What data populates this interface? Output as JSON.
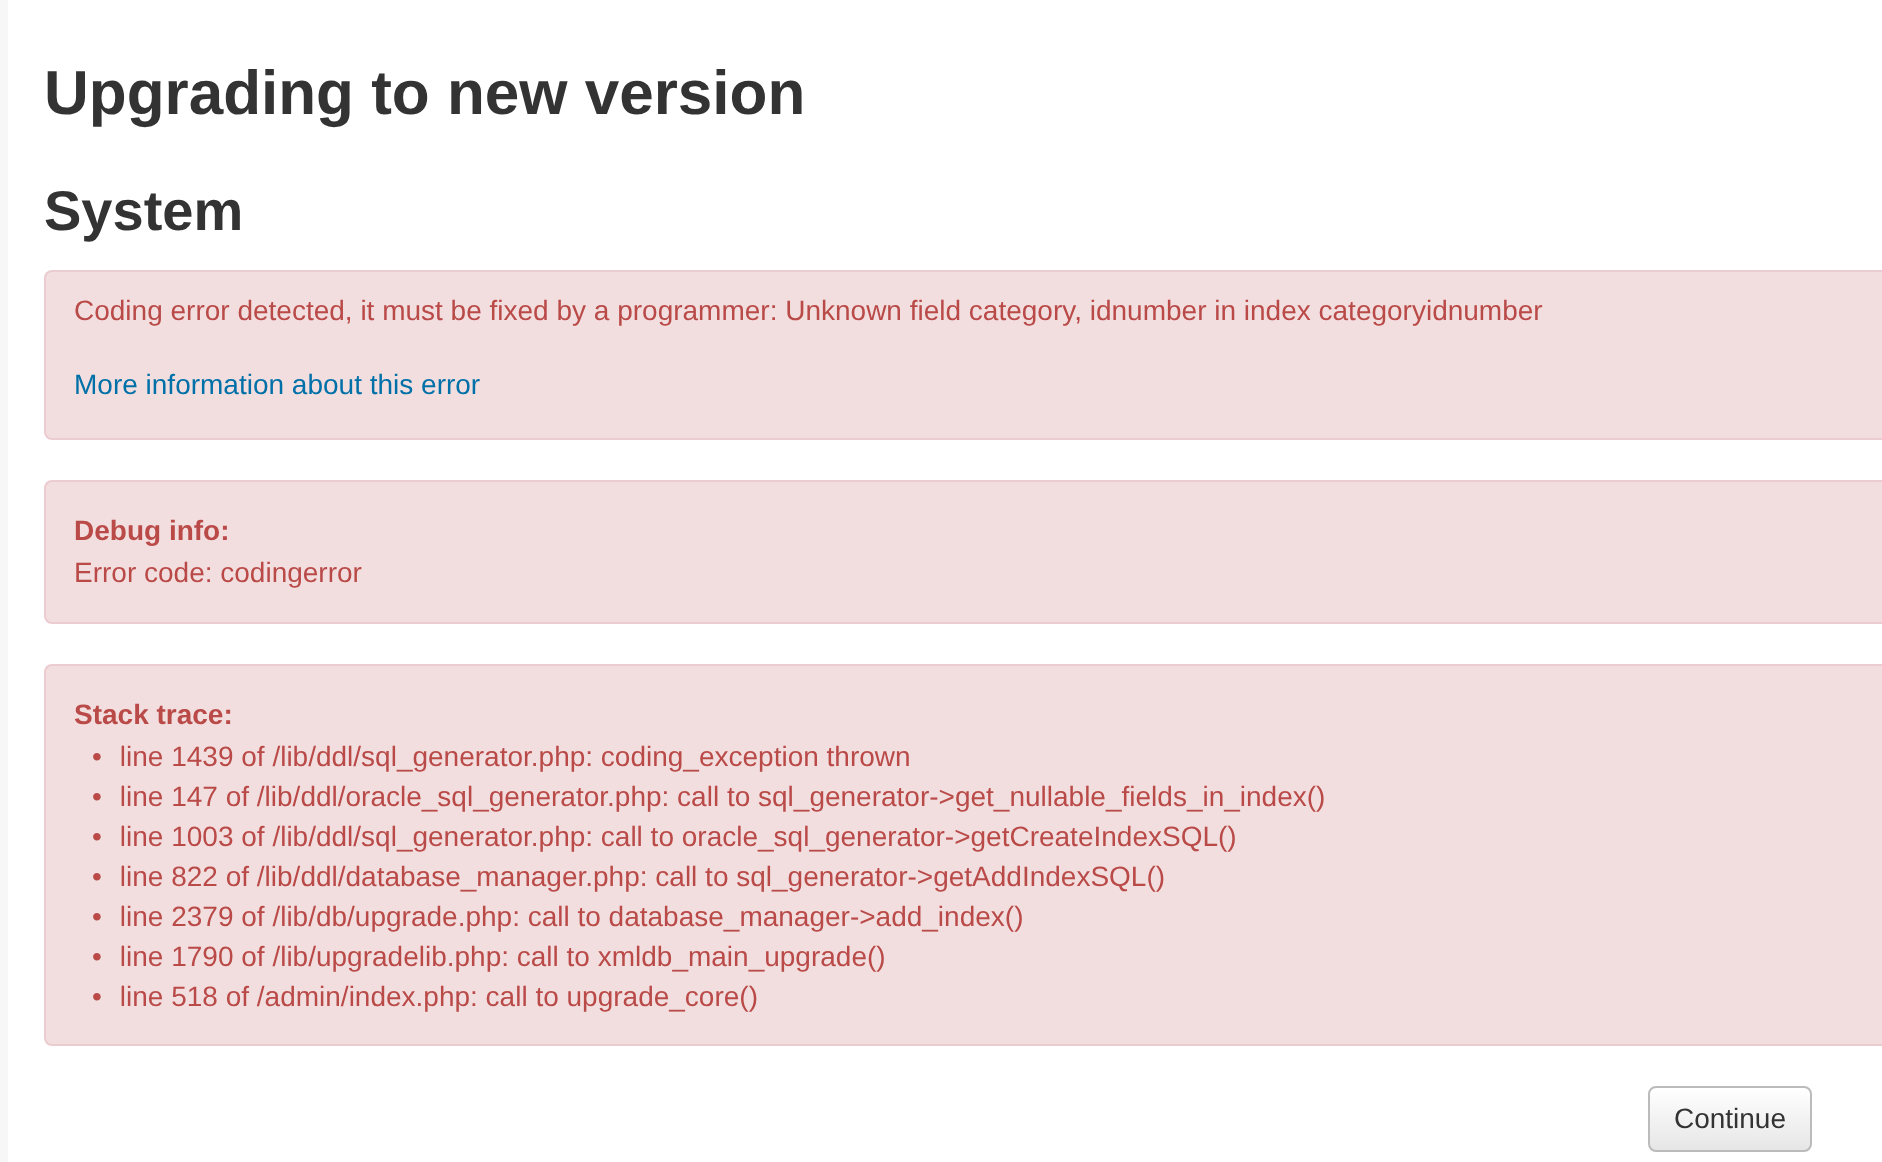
{
  "page_title": "Upgrading to new version",
  "section_title": "System",
  "error": {
    "message": "Coding error detected, it must be fixed by a programmer: Unknown field category, idnumber in index categoryidnumber",
    "link": "More information about this error"
  },
  "debug": {
    "label": "Debug info:",
    "code": "Error code: codingerror"
  },
  "stack": {
    "label": "Stack trace:",
    "marker": "•",
    "lines": [
      "line 1439 of /lib/ddl/sql_generator.php: coding_exception thrown",
      "line 147 of /lib/ddl/oracle_sql_generator.php: call to sql_generator->get_nullable_fields_in_index()",
      "line 1003 of /lib/ddl/sql_generator.php: call to oracle_sql_generator->getCreateIndexSQL()",
      "line 822 of /lib/ddl/database_manager.php: call to sql_generator->getAddIndexSQL()",
      "line 2379 of /lib/db/upgrade.php: call to database_manager->add_index()",
      "line 1790 of /lib/upgradelib.php: call to xmldb_main_upgrade()",
      "line 518 of /admin/index.php: call to upgrade_core()"
    ]
  },
  "continue_button": "Continue"
}
